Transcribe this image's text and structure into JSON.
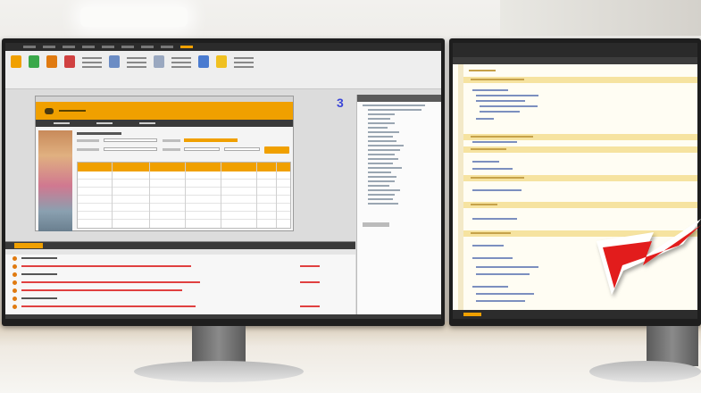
{
  "scene": {
    "description_tag": "dual-monitor-desk-photo"
  },
  "left_screen": {
    "step_number": "3",
    "accent_color": "#f0a000",
    "step_number_color": "#3b46d8"
  },
  "right_screen": {
    "highlight_color": "#f6e3a0"
  },
  "arrow": {
    "color": "#e21b1b"
  }
}
